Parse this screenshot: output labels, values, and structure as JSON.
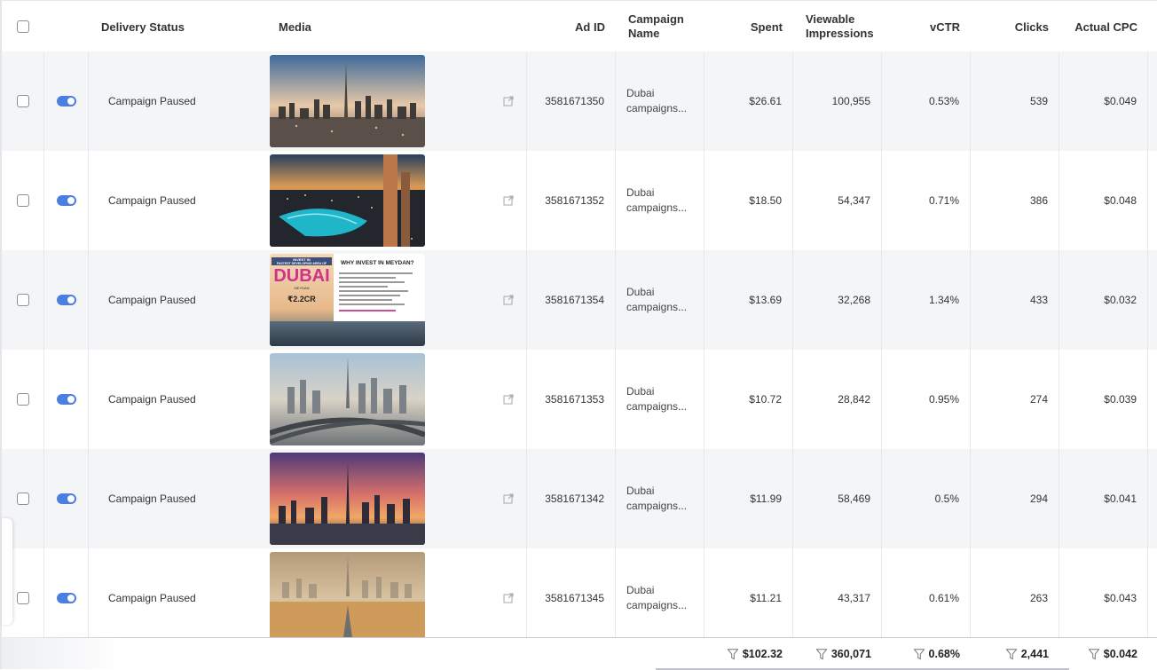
{
  "header": {
    "delivery_status": "Delivery Status",
    "media": "Media",
    "ad_id": "Ad ID",
    "campaign_name_line1": "Campaign",
    "campaign_name_line2": "Name",
    "spent": "Spent",
    "viewable_line1": "Viewable",
    "viewable_line2": "Impressions",
    "vctr": "vCTR",
    "clicks": "Clicks",
    "actual_cpc": "Actual CPC"
  },
  "rows": [
    {
      "status": "Campaign Paused",
      "ad_id": "3581671350",
      "campaign_line1": "Dubai",
      "campaign_line2": "campaigns...",
      "spent": "$26.61",
      "viewable": "100,955",
      "vctr": "0.53%",
      "clicks": "539",
      "cpc": "$0.049",
      "media": "dubai-skyline-sunset"
    },
    {
      "status": "Campaign Paused",
      "ad_id": "3581671352",
      "campaign_line1": "Dubai",
      "campaign_line2": "campaigns...",
      "spent": "$18.50",
      "viewable": "54,347",
      "vctr": "0.71%",
      "clicks": "386",
      "cpc": "$0.048",
      "media": "dubai-marina-night"
    },
    {
      "status": "Campaign Paused",
      "ad_id": "3581671354",
      "campaign_line1": "Dubai",
      "campaign_line2": "campaigns...",
      "spent": "$13.69",
      "viewable": "32,268",
      "vctr": "1.34%",
      "clicks": "433",
      "cpc": "$0.032",
      "media": "meydan-promo-banner"
    },
    {
      "status": "Campaign Paused",
      "ad_id": "3581671353",
      "campaign_line1": "Dubai",
      "campaign_line2": "campaigns...",
      "spent": "$10.72",
      "viewable": "28,842",
      "vctr": "0.95%",
      "clicks": "274",
      "cpc": "$0.039",
      "media": "dubai-highway-aerial"
    },
    {
      "status": "Campaign Paused",
      "ad_id": "3581671342",
      "campaign_line1": "Dubai",
      "campaign_line2": "campaigns...",
      "spent": "$11.99",
      "viewable": "58,469",
      "vctr": "0.5%",
      "clicks": "294",
      "cpc": "$0.041",
      "media": "dubai-purple-dusk"
    },
    {
      "status": "Campaign Paused",
      "ad_id": "3581671345",
      "campaign_line1": "Dubai",
      "campaign_line2": "campaigns...",
      "spent": "$11.21",
      "viewable": "43,317",
      "vctr": "0.61%",
      "clicks": "263",
      "cpc": "$0.043",
      "media": "dubai-desert-haze"
    }
  ],
  "promo": {
    "line1": "INVEST IN",
    "line2": "FASTEST DEVELOPING AREA OF",
    "big": "DUBAI",
    "sub": "MEYDAN",
    "price": "₹2.2CR",
    "heading": "WHY INVEST IN MEYDAN?"
  },
  "totals": {
    "spent": "$102.32",
    "viewable": "360,071",
    "vctr": "0.68%",
    "clicks": "2,441",
    "cpc": "$0.042"
  },
  "icons": {
    "external_link": "external-link-icon",
    "funnel": "filter-funnel-icon"
  },
  "colors": {
    "toggle_on": "#4a7fe0",
    "row_alt": "#f4f5f7"
  }
}
